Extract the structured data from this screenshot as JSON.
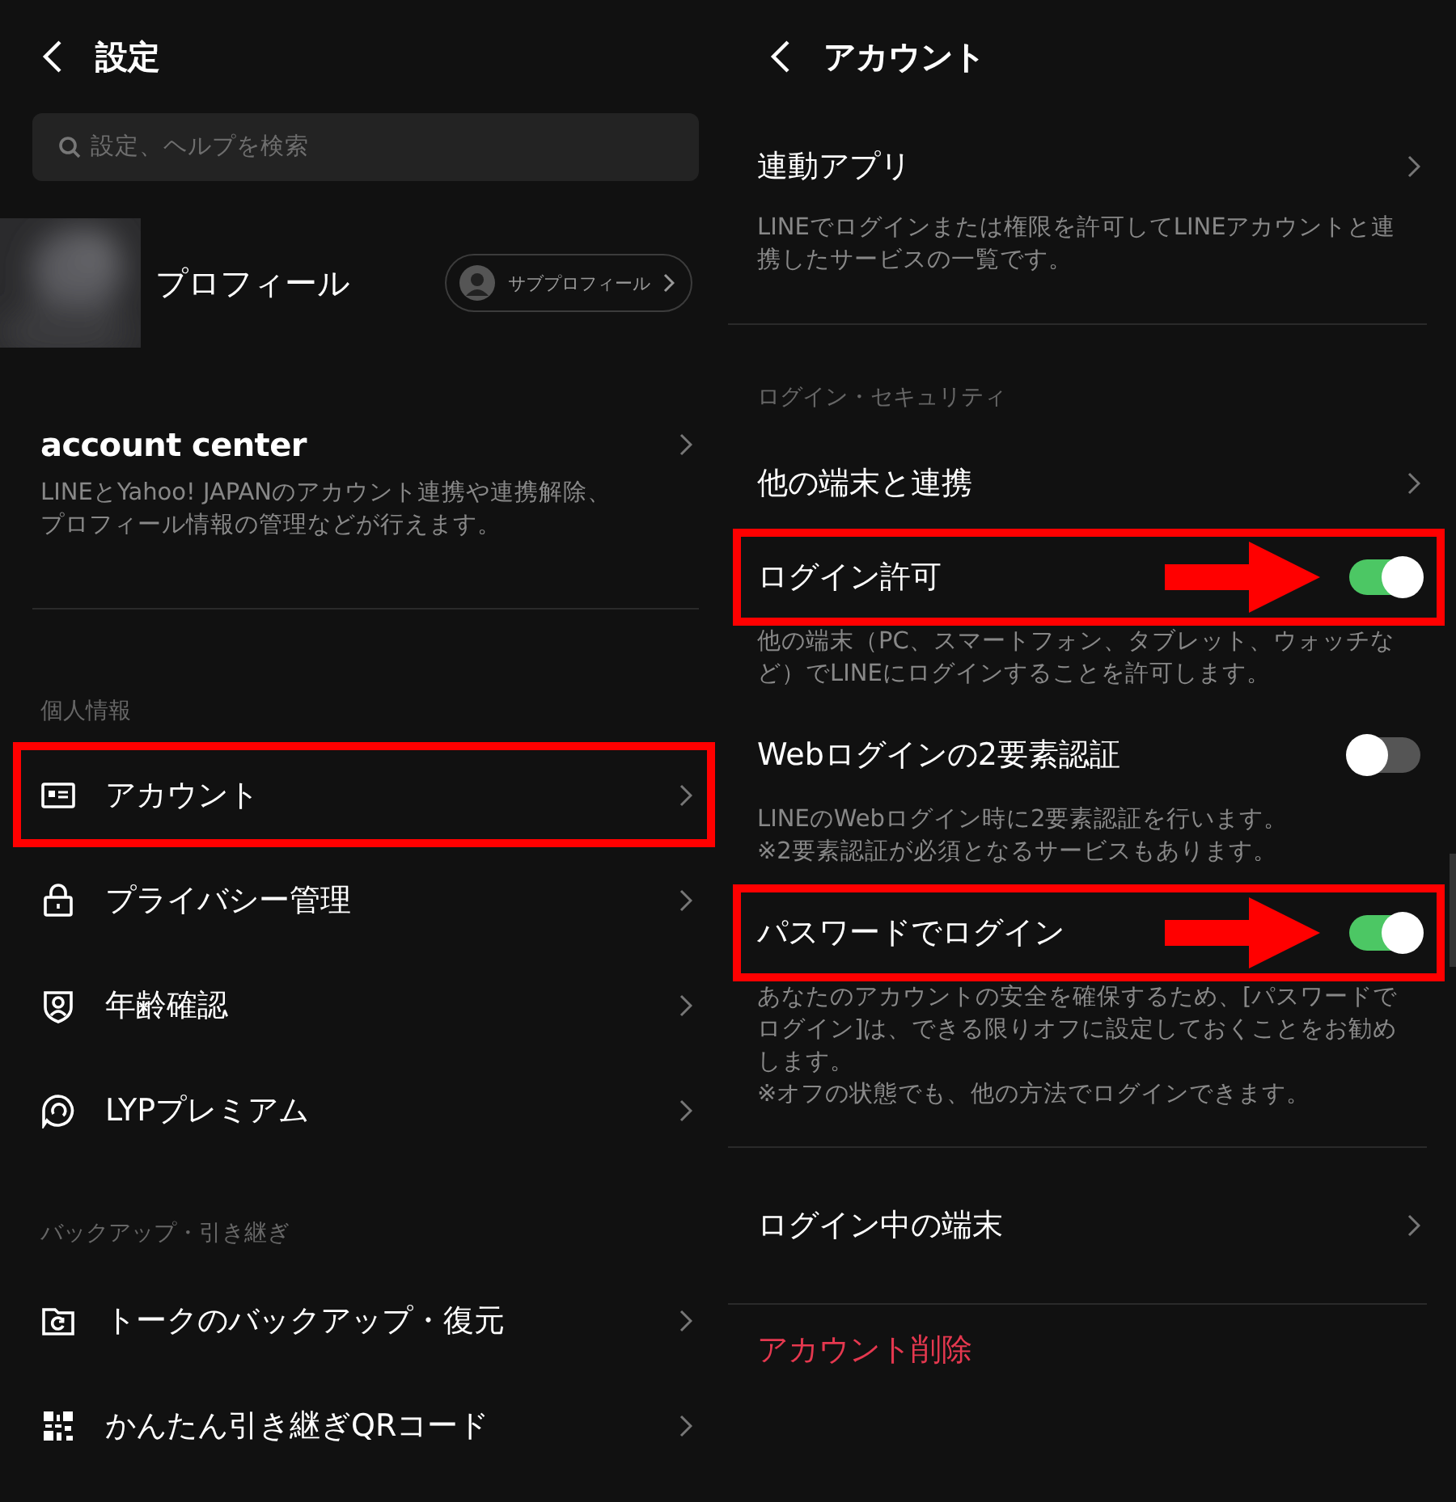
{
  "left": {
    "title": "設定",
    "search": {
      "placeholder": "設定、ヘルプを検索"
    },
    "profile": {
      "name": "プロフィール",
      "sub_button": "サブプロフィール"
    },
    "account_center": {
      "title": "account center",
      "description": "LINEとYahoo! JAPANのアカウント連携や連携解除、プロフィール情報の管理などが行えます。"
    },
    "sections": [
      {
        "title": "個人情報",
        "items": [
          {
            "label": "アカウント",
            "highlighted": true
          },
          {
            "label": "プライバシー管理",
            "highlighted": false
          },
          {
            "label": "年齢確認",
            "highlighted": false
          },
          {
            "label": "LYPプレミアム",
            "highlighted": false
          }
        ]
      },
      {
        "title": "バックアップ・引き継ぎ",
        "items": [
          {
            "label": "トークのバックアップ・復元",
            "highlighted": false
          },
          {
            "label": "かんたん引き継ぎQRコード",
            "highlighted": false
          }
        ]
      }
    ]
  },
  "right": {
    "title": "アカウント",
    "rows": [
      {
        "kind": "link",
        "title": "連動アプリ",
        "description": "LINEでログインまたは権限を許可してLINEアカウントと連携したサービスの一覧です。",
        "divider": true
      },
      {
        "kind": "section",
        "title": "ログイン・セキュリティ"
      },
      {
        "kind": "link",
        "title": "他の端末と連携",
        "divider": false
      },
      {
        "kind": "toggle",
        "title": "ログイン許可",
        "description": "他の端末（PC、スマートフォン、タブレット、ウォッチなど）でLINEにログインすることを許可します。",
        "on": true,
        "highlighted": true
      },
      {
        "kind": "toggle",
        "title": "Webログインの2要素認証",
        "description": "LINEのWebログイン時に2要素認証を行います。\n※2要素認証が必須となるサービスもあります。",
        "on": false,
        "highlighted": false
      },
      {
        "kind": "toggle",
        "title": "パスワードでログイン",
        "description": "あなたのアカウントの安全を確保するため、[パスワードでログイン]は、できる限りオフに設定しておくことをお勧めします。\n※オフの状態でも、他の方法でログインできます。",
        "on": true,
        "highlighted": true,
        "divider": true
      },
      {
        "kind": "link",
        "title": "ログイン中の端末",
        "divider": true
      },
      {
        "kind": "danger",
        "title": "アカウント削除"
      }
    ]
  }
}
